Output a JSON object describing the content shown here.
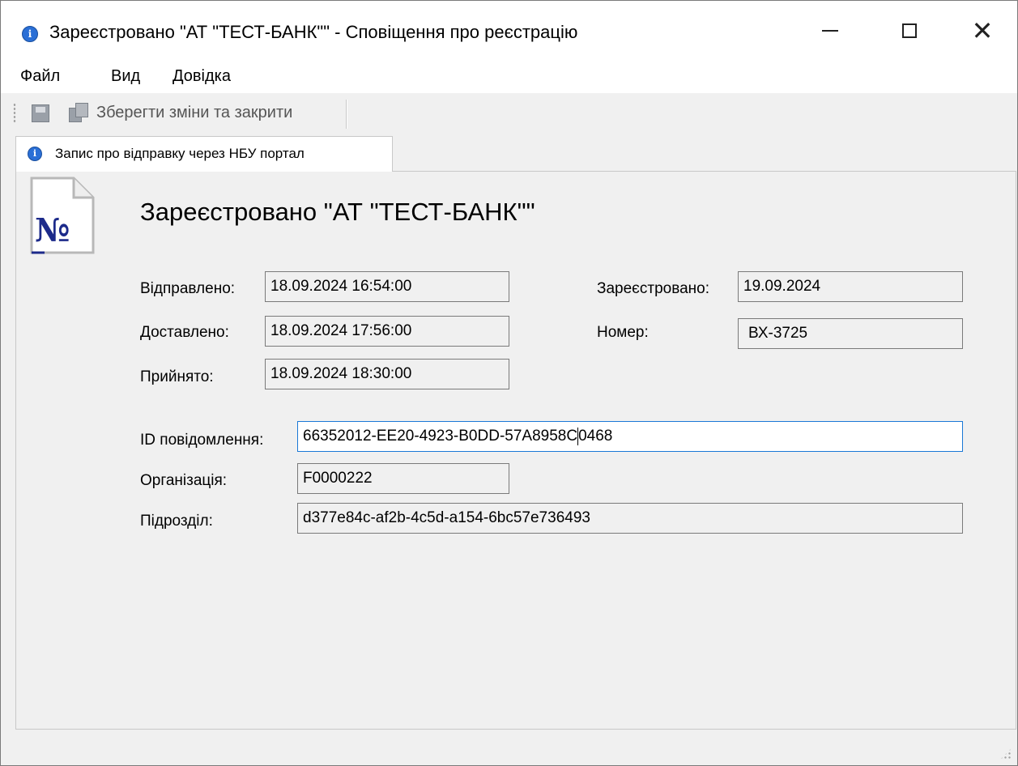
{
  "window": {
    "title": "Зареєстровано \"АТ \"ТЕСТ-БАНК\"\" - Сповіщення про реєстрацію",
    "title_icon": "info-icon"
  },
  "menu": {
    "items": [
      "Файл",
      "Вид",
      "Довідка"
    ]
  },
  "toolbar": {
    "save_icon": "floppy-disk-icon",
    "save_close_icon": "floppy-stack-icon",
    "save_close_label": "Зберегти зміни та закрити"
  },
  "tab": {
    "label": "Запис про відправку через НБУ портал",
    "icon": "info-icon"
  },
  "main": {
    "heading": "Зареєстровано \"АТ \"ТЕСТ-БАНК\"\"",
    "doc_icon": "document-number-icon",
    "fields": {
      "sent": {
        "label": "Відправлено:",
        "value": "18.09.2024 16:54:00"
      },
      "delivered": {
        "label": "Доставлено:",
        "value": "18.09.2024 17:56:00"
      },
      "accepted": {
        "label": "Прийнято:",
        "value": "18.09.2024 18:30:00"
      },
      "registered": {
        "label": "Зареєстровано:",
        "value": "19.09.2024"
      },
      "number": {
        "label": "Номер:",
        "value": "ВХ-3725"
      },
      "message_id": {
        "label": "ID повідомлення:",
        "value_before_caret": "66352012-EE20-4923-B0DD-57A8958C",
        "value_after_caret": "0468"
      },
      "organization": {
        "label": "Організація:",
        "value": "F0000222"
      },
      "subdivision": {
        "label": "Підрозділ:",
        "value": "d377e84c-af2b-4c5d-a154-6bc57e736493"
      }
    }
  },
  "colors": {
    "active_border": "#1a78d6",
    "info_icon": "#2a6fd6",
    "doc_icon_blue": "#1c2a8a"
  }
}
